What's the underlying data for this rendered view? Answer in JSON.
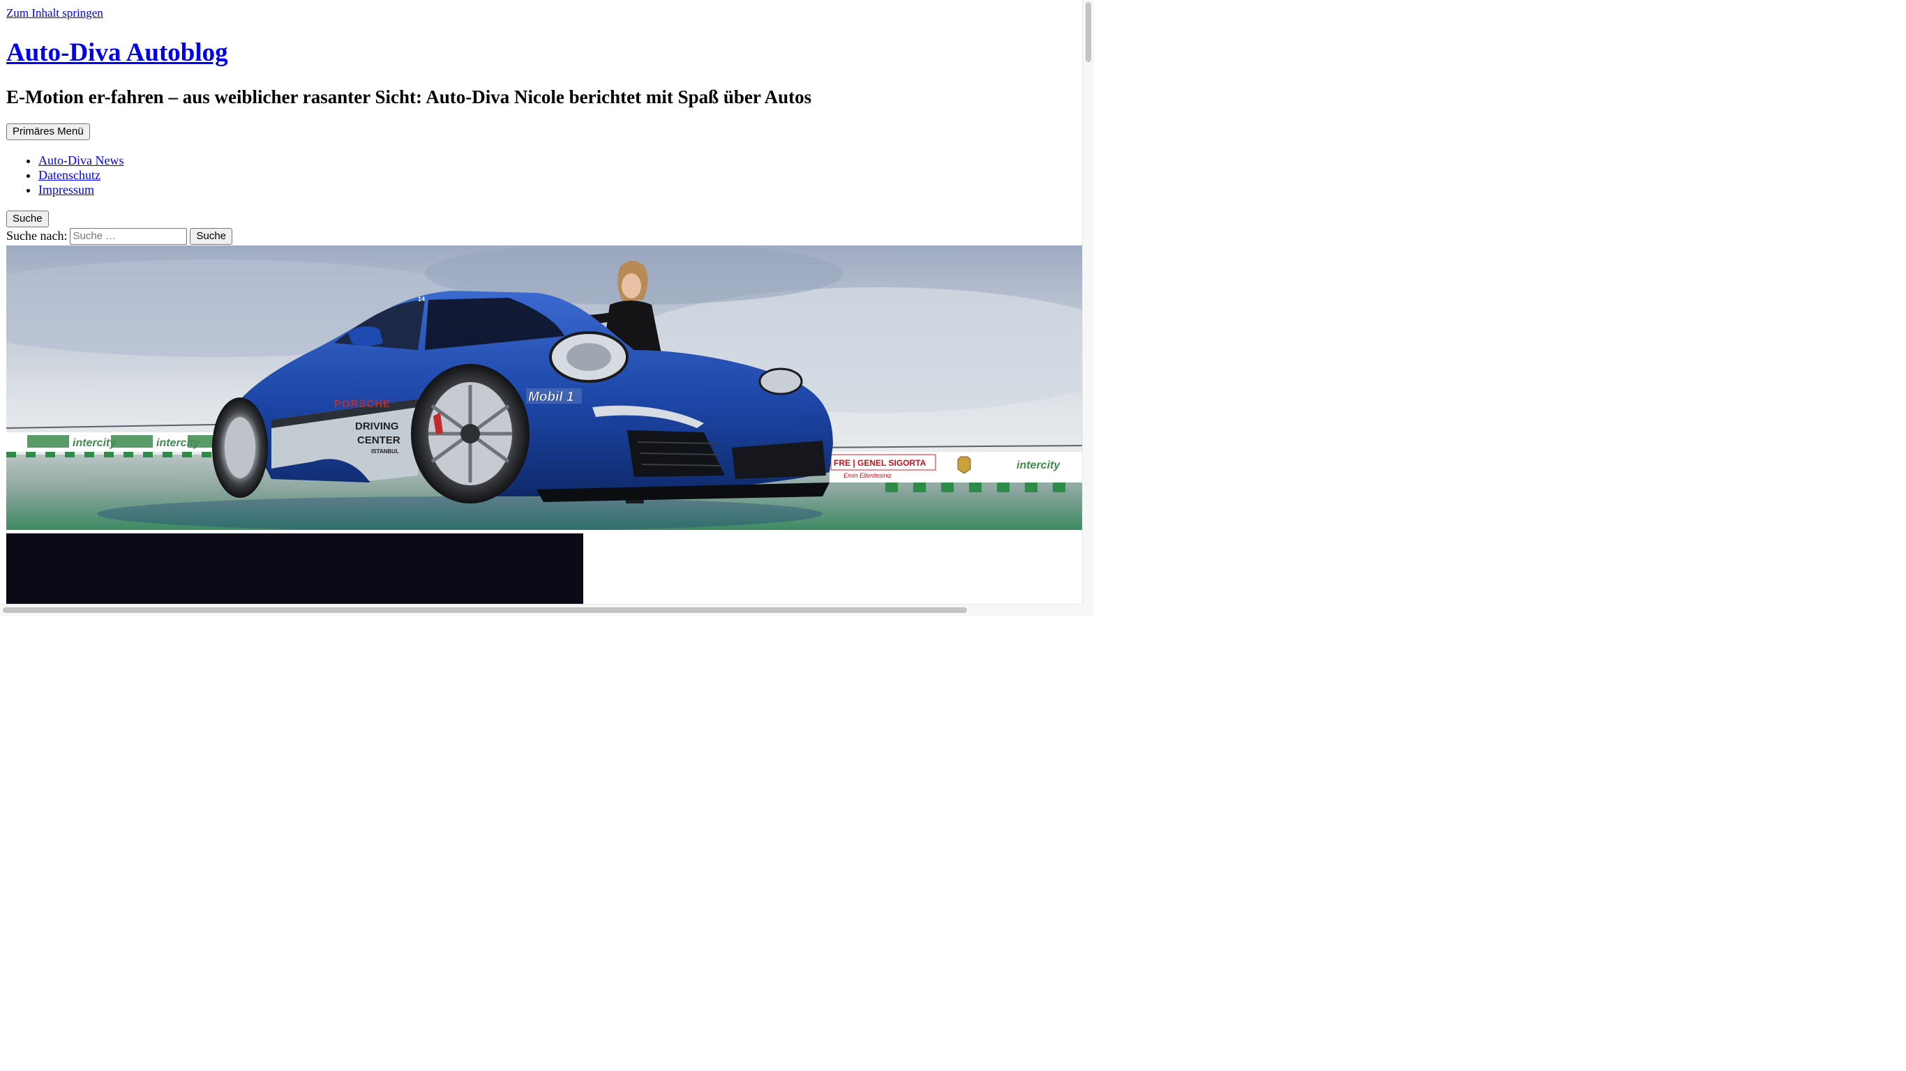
{
  "skip_link": "Zum Inhalt springen",
  "site": {
    "title": "Auto-Diva Autoblog",
    "description": "E-Motion er-fahren – aus weiblicher rasanter Sicht: Auto-Diva Nicole berichtet mit Spaß über Autos"
  },
  "menu": {
    "toggle_label": "Primäres Menü",
    "items": [
      {
        "label": "Auto-Diva News"
      },
      {
        "label": "Datenschutz"
      },
      {
        "label": "Impressum"
      }
    ]
  },
  "search": {
    "toggle_label": "Suche",
    "label": "Suche nach:",
    "placeholder": "Suche …",
    "submit_label": "Suche"
  },
  "header_image": {
    "car_text": {
      "brand": "PORSCHE",
      "line1": "DRIVING",
      "line2": "CENTER",
      "line3": "ISTANBUL",
      "number": "14",
      "sponsor": "Mobil 1"
    },
    "banners": {
      "intercity": "intercity",
      "insurance": "FRE | GENEL SIGORTA",
      "insurance_sub": "Emin Ellerdesiniz"
    }
  },
  "colors": {
    "link": "#0000ee",
    "sky": "#a9b6cc",
    "car_blue": "#1c45a6",
    "track_green": "#3f9a5e",
    "dark_block": "#0b0a16"
  }
}
